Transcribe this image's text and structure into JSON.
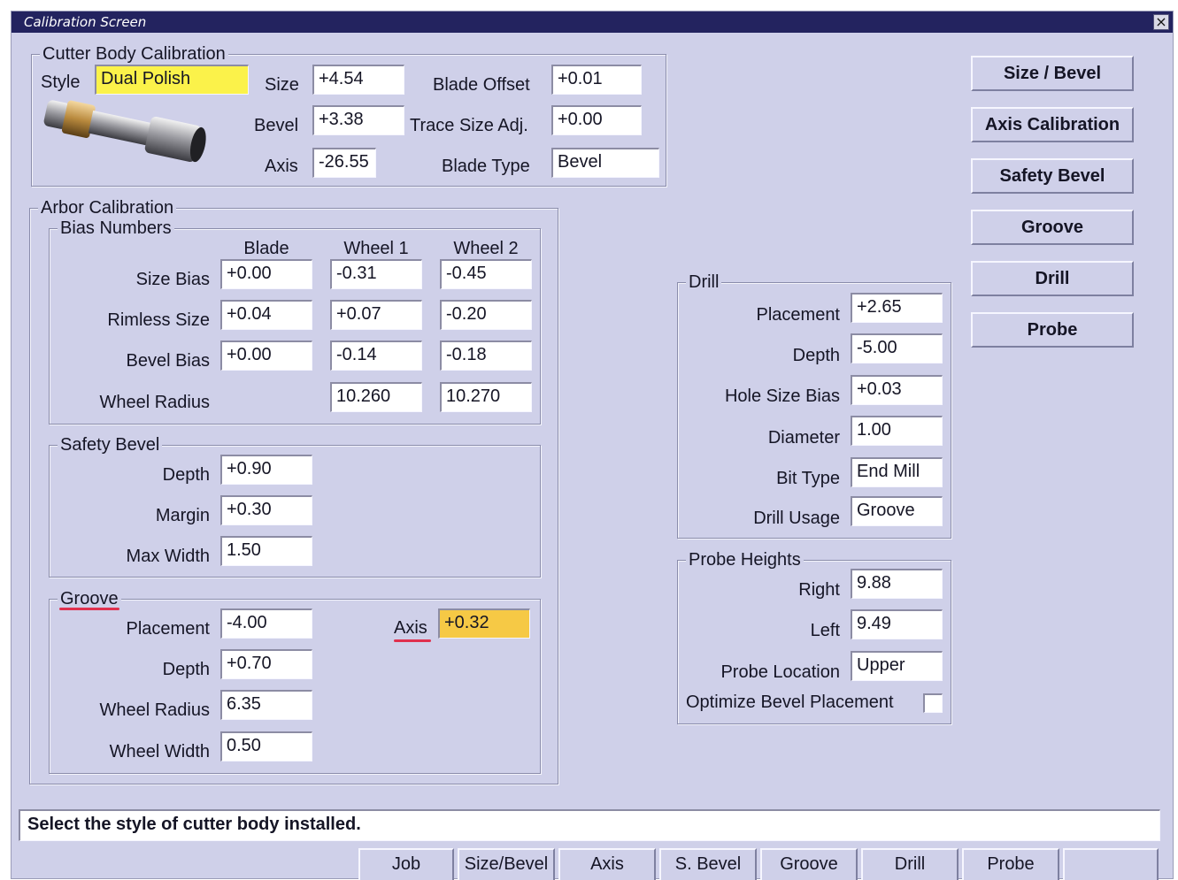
{
  "window": {
    "title": "Calibration Screen"
  },
  "cutter_body": {
    "legend": "Cutter Body Calibration",
    "style_label": "Style",
    "style_value": "Dual Polish",
    "size_label": "Size",
    "size_value": "+4.54",
    "bevel_label": "Bevel",
    "bevel_value": "+3.38",
    "axis_label": "Axis",
    "axis_value": "-26.55",
    "blade_offset_label": "Blade Offset",
    "blade_offset_value": "+0.01",
    "trace_size_label": "Trace Size Adj.",
    "trace_size_value": "+0.00",
    "blade_type_label": "Blade Type",
    "blade_type_value": "Bevel"
  },
  "arbor": {
    "legend": "Arbor Calibration",
    "bias": {
      "legend": "Bias Numbers",
      "col_headers": [
        "Blade",
        "Wheel 1",
        "Wheel 2"
      ],
      "rows": [
        {
          "label": "Size Bias",
          "values": [
            "+0.00",
            "-0.31",
            "-0.45"
          ]
        },
        {
          "label": "Rimless Size",
          "values": [
            "+0.04",
            "+0.07",
            "-0.20"
          ]
        },
        {
          "label": "Bevel Bias",
          "values": [
            "+0.00",
            "-0.14",
            "-0.18"
          ]
        },
        {
          "label": "Wheel Radius",
          "values": [
            "",
            "10.260",
            "10.270"
          ]
        }
      ]
    },
    "safety_bevel": {
      "legend": "Safety Bevel",
      "rows": [
        {
          "label": "Depth",
          "value": "+0.90"
        },
        {
          "label": "Margin",
          "value": "+0.30"
        },
        {
          "label": "Max Width",
          "value": "1.50"
        }
      ]
    },
    "groove": {
      "legend": "Groove",
      "rows": [
        {
          "label": "Placement",
          "value": "-4.00"
        },
        {
          "label": "Depth",
          "value": "+0.70"
        },
        {
          "label": "Wheel Radius",
          "value": "6.35"
        },
        {
          "label": "Wheel Width",
          "value": "0.50"
        }
      ],
      "axis_label": "Axis",
      "axis_value": "+0.32"
    }
  },
  "drill": {
    "legend": "Drill",
    "rows": [
      {
        "label": "Placement",
        "value": "+2.65"
      },
      {
        "label": "Depth",
        "value": "-5.00"
      },
      {
        "label": "Hole Size Bias",
        "value": "+0.03"
      },
      {
        "label": "Diameter",
        "value": "1.00"
      },
      {
        "label": "Bit Type",
        "value": "End Mill"
      },
      {
        "label": "Drill Usage",
        "value": "Groove"
      }
    ]
  },
  "probe": {
    "legend": "Probe Heights",
    "rows": [
      {
        "label": "Right",
        "value": "9.88"
      },
      {
        "label": "Left",
        "value": "9.49"
      },
      {
        "label": "Probe Location",
        "value": "Upper"
      }
    ],
    "optimize_label": "Optimize Bevel Placement"
  },
  "side_buttons": [
    "Size / Bevel",
    "Axis Calibration",
    "Safety Bevel",
    "Groove",
    "Drill",
    "Probe"
  ],
  "status": "Select the style of cutter body installed.",
  "tabs": [
    "Job",
    "Size/Bevel",
    "Axis",
    "S. Bevel",
    "Groove",
    "Drill",
    "Probe",
    ""
  ],
  "colors": {
    "panel_bg": "#cfd0e9",
    "title_bar": "#23235f",
    "style_highlight": "#fbf24a",
    "axis_highlight": "#f6c945",
    "underline": "#e0304e"
  }
}
